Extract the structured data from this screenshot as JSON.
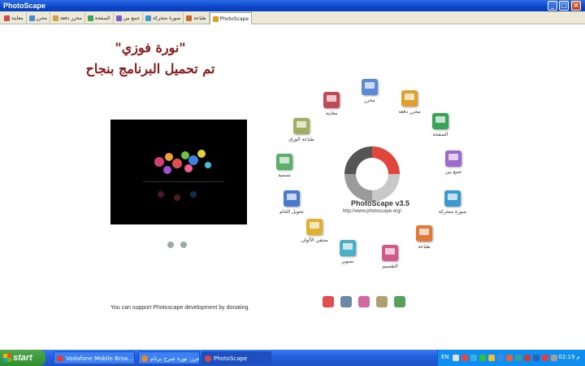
{
  "window": {
    "title": "PhotoScape",
    "buttons": [
      "_",
      "□",
      "×"
    ]
  },
  "tabs": [
    {
      "label": "معاينة",
      "color": "#d04a4a"
    },
    {
      "label": "محرر",
      "color": "#4a8ad0"
    },
    {
      "label": "محرر دفعة",
      "color": "#d0a04a"
    },
    {
      "label": "الصفحة",
      "color": "#3aa35a"
    },
    {
      "label": "جمع بين",
      "color": "#7a5ad0"
    },
    {
      "label": "صورة متحركة",
      "color": "#3a9ad0"
    },
    {
      "label": "طباعة",
      "color": "#c86a2a"
    },
    {
      "label": "PhotoScape",
      "color": "#e0a020",
      "active": true
    }
  ],
  "heading": {
    "line1": "\"نورة فوزي\"",
    "line2": "تم تحميل البرنامج بنجاح"
  },
  "donate_text": "You can support Photoscape development by donating.",
  "logo": {
    "name": "PhotoScape v3.5",
    "url": "http://www.photoscape.org/"
  },
  "ring_items": [
    {
      "label": "محرر",
      "color": "#5a8ad8",
      "icon": "editor-icon"
    },
    {
      "label": "محرر دفعة",
      "color": "#e0a030",
      "icon": "batch-editor-icon"
    },
    {
      "label": "الصفحة",
      "color": "#3aa35a",
      "icon": "page-icon"
    },
    {
      "label": "جمع بين",
      "color": "#9a6ad0",
      "icon": "combine-icon"
    },
    {
      "label": "صورة متحركة",
      "color": "#3a9ad0",
      "icon": "animated-gif-icon"
    },
    {
      "label": "طباعة",
      "color": "#e07a3a",
      "icon": "print-icon"
    },
    {
      "label": "التقسيم",
      "color": "#d05a8a",
      "icon": "splitter-icon"
    },
    {
      "label": "تصوير",
      "color": "#4ab0c8",
      "icon": "screen-capture-icon"
    },
    {
      "label": "منتقي الألوان",
      "color": "#e0b030",
      "icon": "color-picker-icon"
    },
    {
      "label": "تحويل الخام",
      "color": "#4a7ad0",
      "icon": "raw-converter-icon"
    },
    {
      "label": "تسمية",
      "color": "#5ab06a",
      "icon": "rename-icon"
    },
    {
      "label": "طباعة الورق",
      "color": "#a0b060",
      "icon": "paper-print-icon"
    },
    {
      "label": "معاينة",
      "color": "#c04a5a",
      "icon": "viewer-icon"
    }
  ],
  "bottom_icons": [
    {
      "icon": "help-icon",
      "color": "#e05050"
    },
    {
      "icon": "tools-icon",
      "color": "#6a8aa8"
    },
    {
      "icon": "people-icon",
      "color": "#d06aa0"
    },
    {
      "icon": "face-search-icon",
      "color": "#b0a070"
    },
    {
      "icon": "photo-frame-icon",
      "color": "#5aa05a"
    }
  ],
  "taskbar": {
    "start_label": "start",
    "tasks": [
      {
        "label": "Vodafone Mobile Broa...",
        "color": "#e03a3a"
      },
      {
        "label": "محرر: نورة شرح برنام...",
        "color": "#e08a30"
      },
      {
        "label": "PhotoScape",
        "color": "#d04a4a",
        "active": true
      }
    ],
    "lang": "EN",
    "clock": "02:19 م",
    "tray_colors": [
      "#e0e0e0",
      "#e04a4a",
      "#3ab0e0",
      "#30c040",
      "#f0c030",
      "#3a8ae0",
      "#e06040",
      "#30a0a0",
      "#c04040",
      "#2a60c0",
      "#e04040",
      "#a0a0a0"
    ]
  }
}
